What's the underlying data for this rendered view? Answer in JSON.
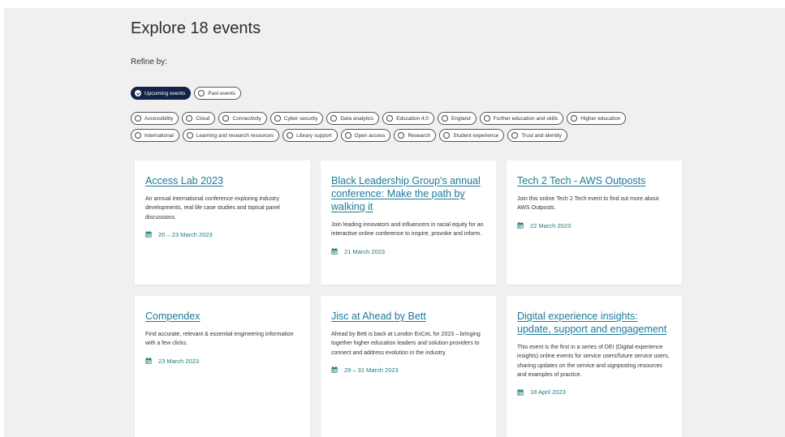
{
  "header": {
    "title": "Explore 18 events",
    "refine_label": "Refine by:"
  },
  "time_filters": [
    {
      "label": "Upcoming events",
      "selected": true
    },
    {
      "label": "Past events",
      "selected": false
    }
  ],
  "topic_filters_row1": [
    "Accessibility",
    "Cloud",
    "Connectivity",
    "Cyber security",
    "Data analytics",
    "Education 4.0",
    "England",
    "Further education and skills",
    "Higher education"
  ],
  "topic_filters_row2": [
    "International",
    "Learning and research resources",
    "Library support",
    "Open access",
    "Research",
    "Student experience",
    "Trust and identity"
  ],
  "events": [
    {
      "title": "Access Lab 2023",
      "description": "An annual international conference exploring industry developments, real life case studies and topical panel discussions.",
      "date": "20 – 23 March 2023"
    },
    {
      "title": "Black Leadership Group's annual conference: Make the path by walking it",
      "description": "Join leading innovators and influencers in racial equity for an interactive online conference to inspire, provoke and inform.",
      "date": "21 March 2023"
    },
    {
      "title": "Tech 2 Tech - AWS Outposts",
      "description": "Join this online Tech 2 Tech event to find out more about AWS Outposts.",
      "date": "22 March 2023"
    },
    {
      "title": "Compendex",
      "description": "Find accurate, relevant & essential engineering information with a few clicks.",
      "date": "23 March 2023"
    },
    {
      "title": "Jisc at Ahead by Bett",
      "description": "Ahead by Bett is back at London ExCeL for 2023 – bringing together higher education leaders and solution providers to connect and address evolution in the industry.",
      "date": "29 – 31 March 2023"
    },
    {
      "title": "Digital experience insights: update, support and engagement",
      "description": "This event is the first in a series of DEI (Digital experience insights) online events for service users/future service users, sharing updates on the service and signposting resources and examples of practice.",
      "date": "18 April 2023"
    }
  ],
  "icons": {
    "date": "calendar-icon",
    "chip": "radio-circle-icon",
    "chip_selected": "check-circle-icon"
  },
  "colors": {
    "accent_link": "#1a7a9a",
    "selected_chip": "#12234a",
    "page_background": "#f0f0f0"
  }
}
